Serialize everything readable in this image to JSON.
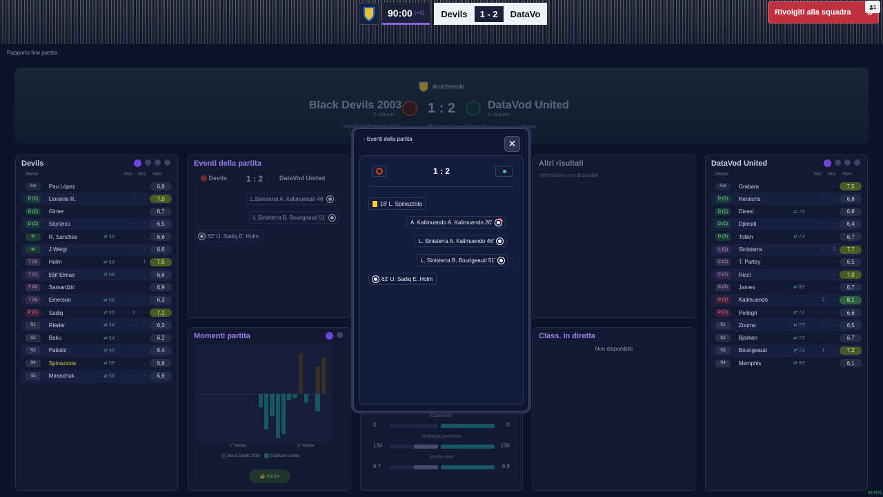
{
  "topbar": {
    "time": "90:00",
    "added_time": "(+5)",
    "home_short": "Devils",
    "score": "1 - 2",
    "away_short": "DataVo"
  },
  "back_button": {
    "label": "Rivolgiti alla squadra",
    "notif_count": "1"
  },
  "breadcrumb": "Rapporto fine partita",
  "header": {
    "competition": "Amichevole",
    "home_team": "Black Devils 2003",
    "home_coach": "T. Gillman",
    "away_team": "DataVod United",
    "away_coach": "S. Giuntini",
    "score": "1 : 2",
    "date": "venerdì 13 dicembre 2024",
    "stadium": "Diego Armando Maradona",
    "weather": "Sereno"
  },
  "home_lineup": {
    "title": "Devils",
    "col_name": "Nome",
    "col_gol": "Gol",
    "col_ass": "Ass",
    "col_vote": "Voto",
    "players": [
      {
        "pos": "Por",
        "name": "Pau López",
        "sub": "",
        "gol": "-",
        "ass": "-",
        "vote": "6,8"
      },
      {
        "pos": "D (C)",
        "name": "Llorente R.",
        "sub": "",
        "gol": "-",
        "ass": "-",
        "vote": "7,0"
      },
      {
        "pos": "D (C)",
        "name": "Ginter",
        "sub": "",
        "gol": "-",
        "ass": "-",
        "vote": "6,7"
      },
      {
        "pos": "D (C)",
        "name": "Söyüncü",
        "sub": "",
        "gol": "-",
        "ass": "-",
        "vote": "6,5"
      },
      {
        "pos": "M",
        "name": "R. Sanches",
        "sub": "54'",
        "gol": "-",
        "ass": "-",
        "vote": "6,6"
      },
      {
        "pos": "M",
        "name": "J.Weigl",
        "sub": "",
        "gol": "-",
        "ass": "-",
        "vote": "6,6"
      },
      {
        "pos": "T (D)",
        "name": "Holm",
        "sub": "54'",
        "gol": "-",
        "ass": "1",
        "vote": "7,5"
      },
      {
        "pos": "T (C)",
        "name": "Eljif Elmas",
        "sub": "58'",
        "gol": "-",
        "ass": "-",
        "vote": "6,6"
      },
      {
        "pos": "T (C)",
        "name": "Samardžić",
        "sub": "",
        "gol": "-",
        "ass": "-",
        "vote": "6,9"
      },
      {
        "pos": "T (S)",
        "name": "Emerson",
        "sub": "58'",
        "gol": "-",
        "ass": "-",
        "vote": "6,3"
      },
      {
        "pos": "P (C)",
        "name": "Sadiq",
        "sub": "45'",
        "gol": "1",
        "ass": "-",
        "vote": "7,1"
      },
      {
        "pos": "S1",
        "name": "Rieder",
        "sub": "54'",
        "gol": "-",
        "ass": "-",
        "vote": "6,3"
      },
      {
        "pos": "S2",
        "name": "Baku",
        "sub": "54'",
        "gol": "-",
        "ass": "-",
        "vote": "6,2"
      },
      {
        "pos": "S3",
        "name": "Pašalić",
        "sub": "45'",
        "gol": "-",
        "ass": "-",
        "vote": "6,4"
      },
      {
        "pos": "S4",
        "name": "Spinazzola",
        "sub": "58'",
        "gol": "-",
        "ass": "-",
        "vote": "6,6"
      },
      {
        "pos": "S5",
        "name": "Miranchuk",
        "sub": "58'",
        "gol": "-",
        "ass": "-",
        "vote": "6,6"
      }
    ]
  },
  "away_lineup": {
    "title": "DataVod United",
    "col_name": "Nome",
    "col_gol": "Gol",
    "col_ass": "Ass",
    "col_vote": "Voto",
    "players": [
      {
        "pos": "Por",
        "name": "Grabara",
        "sub": "",
        "gol": "-",
        "ass": "-",
        "vote": "7,5"
      },
      {
        "pos": "D (D)",
        "name": "Henrichs",
        "sub": "",
        "gol": "-",
        "ass": "-",
        "vote": "6,8"
      },
      {
        "pos": "D (C)",
        "name": "Disasi",
        "sub": "73'",
        "gol": "-",
        "ass": "-",
        "vote": "6,8"
      },
      {
        "pos": "D (C)",
        "name": "Djimsiti",
        "sub": "",
        "gol": "-",
        "ass": "-",
        "vote": "6,4"
      },
      {
        "pos": "D (S)",
        "name": "Tolkin",
        "sub": "73'",
        "gol": "-",
        "ass": "-",
        "vote": "6,7"
      },
      {
        "pos": "C (D)",
        "name": "Sinisterra",
        "sub": "",
        "gol": "-",
        "ass": "2",
        "vote": "7,7"
      },
      {
        "pos": "C (C)",
        "name": "T. Partey",
        "sub": "",
        "gol": "-",
        "ass": "-",
        "vote": "6,5"
      },
      {
        "pos": "C (C)",
        "name": "Ricci",
        "sub": "",
        "gol": "-",
        "ass": "-",
        "vote": "7,0"
      },
      {
        "pos": "C (S)",
        "name": "James",
        "sub": "88'",
        "gol": "-",
        "ass": "-",
        "vote": "6,7"
      },
      {
        "pos": "P (C)",
        "name": "Kalimuendo",
        "sub": "",
        "gol": "2",
        "ass": "-",
        "vote": "8,1"
      },
      {
        "pos": "P (C)",
        "name": "Pellegri",
        "sub": "73'",
        "gol": "-",
        "ass": "-",
        "vote": "6,6"
      },
      {
        "pos": "S1",
        "name": "Zouma",
        "sub": "73'",
        "gol": "-",
        "ass": "-",
        "vote": "6,5"
      },
      {
        "pos": "S2",
        "name": "Bjarkan",
        "sub": "73'",
        "gol": "-",
        "ass": "-",
        "vote": "6,7"
      },
      {
        "pos": "S3",
        "name": "Bourigeaud",
        "sub": "73'",
        "gol": "1",
        "ass": "-",
        "vote": "7,2"
      },
      {
        "pos": "S4",
        "name": "Memphis",
        "sub": "88'",
        "gol": "-",
        "ass": "-",
        "vote": "6,1"
      }
    ]
  },
  "events_panel": {
    "title": "Eventi della partita",
    "home": "Devils",
    "score": "1 : 2",
    "away": "DataVod United",
    "events": [
      "L.Sinisterra  A. Kalimuendo  46'",
      "L.Sinisterra  B. Bourigeaud  51'",
      "62'  U. Sadiq  E. Holm"
    ]
  },
  "results_panel": {
    "title": "Altri risultati",
    "text": "Informazioni non disponibili"
  },
  "momentum_panel": {
    "title": "Momenti partita",
    "half1": "1° tempo",
    "half2": "2° tempo",
    "legend_home": "Black Devils 2003",
    "legend_away": "DataVod United",
    "button": "Medie"
  },
  "chart_data": {
    "type": "bar",
    "title": "Momenti partita",
    "series": [
      {
        "name": "Black Devils 2003",
        "values": [
          0,
          0,
          0,
          0,
          0,
          0,
          0,
          0,
          0,
          0,
          0,
          0,
          0,
          0,
          0,
          0,
          0,
          0,
          0.9,
          0,
          0,
          0.6,
          0.8,
          0
        ]
      },
      {
        "name": "DataVod United",
        "values": [
          0,
          0,
          0,
          0,
          0,
          0,
          0,
          0,
          0,
          0,
          0,
          0.3,
          0.8,
          0.5,
          1.0,
          0.9,
          0.15,
          0.1,
          0,
          0.2,
          0,
          0.4,
          0,
          0
        ]
      }
    ],
    "ylim": [
      -1,
      1
    ]
  },
  "live_table_panel": {
    "title": "Class. in diretta",
    "text": "Non disponibile"
  },
  "stats": [
    {
      "label": "Espulsioni",
      "home": "0",
      "away": "0",
      "home_pct": 0,
      "away_pct": 1
    },
    {
      "label": "Distanza percorsa",
      "home": "134",
      "away": "130",
      "home_pct": 0.5,
      "away_pct": 1
    },
    {
      "label": "Media voto",
      "home": "6,7",
      "away": "6,9",
      "home_pct": 0.5,
      "away_pct": 1
    }
  ],
  "modal": {
    "title": "Eventi della partita",
    "score": "1 : 2",
    "events": [
      {
        "text": "16'  L. Spinazzola",
        "type": "card"
      },
      {
        "text": "A. Kalimuendo  A. Kalimuendo  26'",
        "type": "goal-pen"
      },
      {
        "text": "L. Sinisterra  A. Kalimuendo  46'",
        "type": "goal"
      },
      {
        "text": "L. Sinisterra  B. Bourigeaud  51'",
        "type": "goal"
      },
      {
        "text": "62'  U. Sadiq  E. Holm",
        "type": "goal"
      }
    ]
  },
  "fps": "29 FPS",
  "colors": {
    "accent": "#6e45d9",
    "back_button": "#c0303e",
    "teal": "#1c8a8c"
  }
}
